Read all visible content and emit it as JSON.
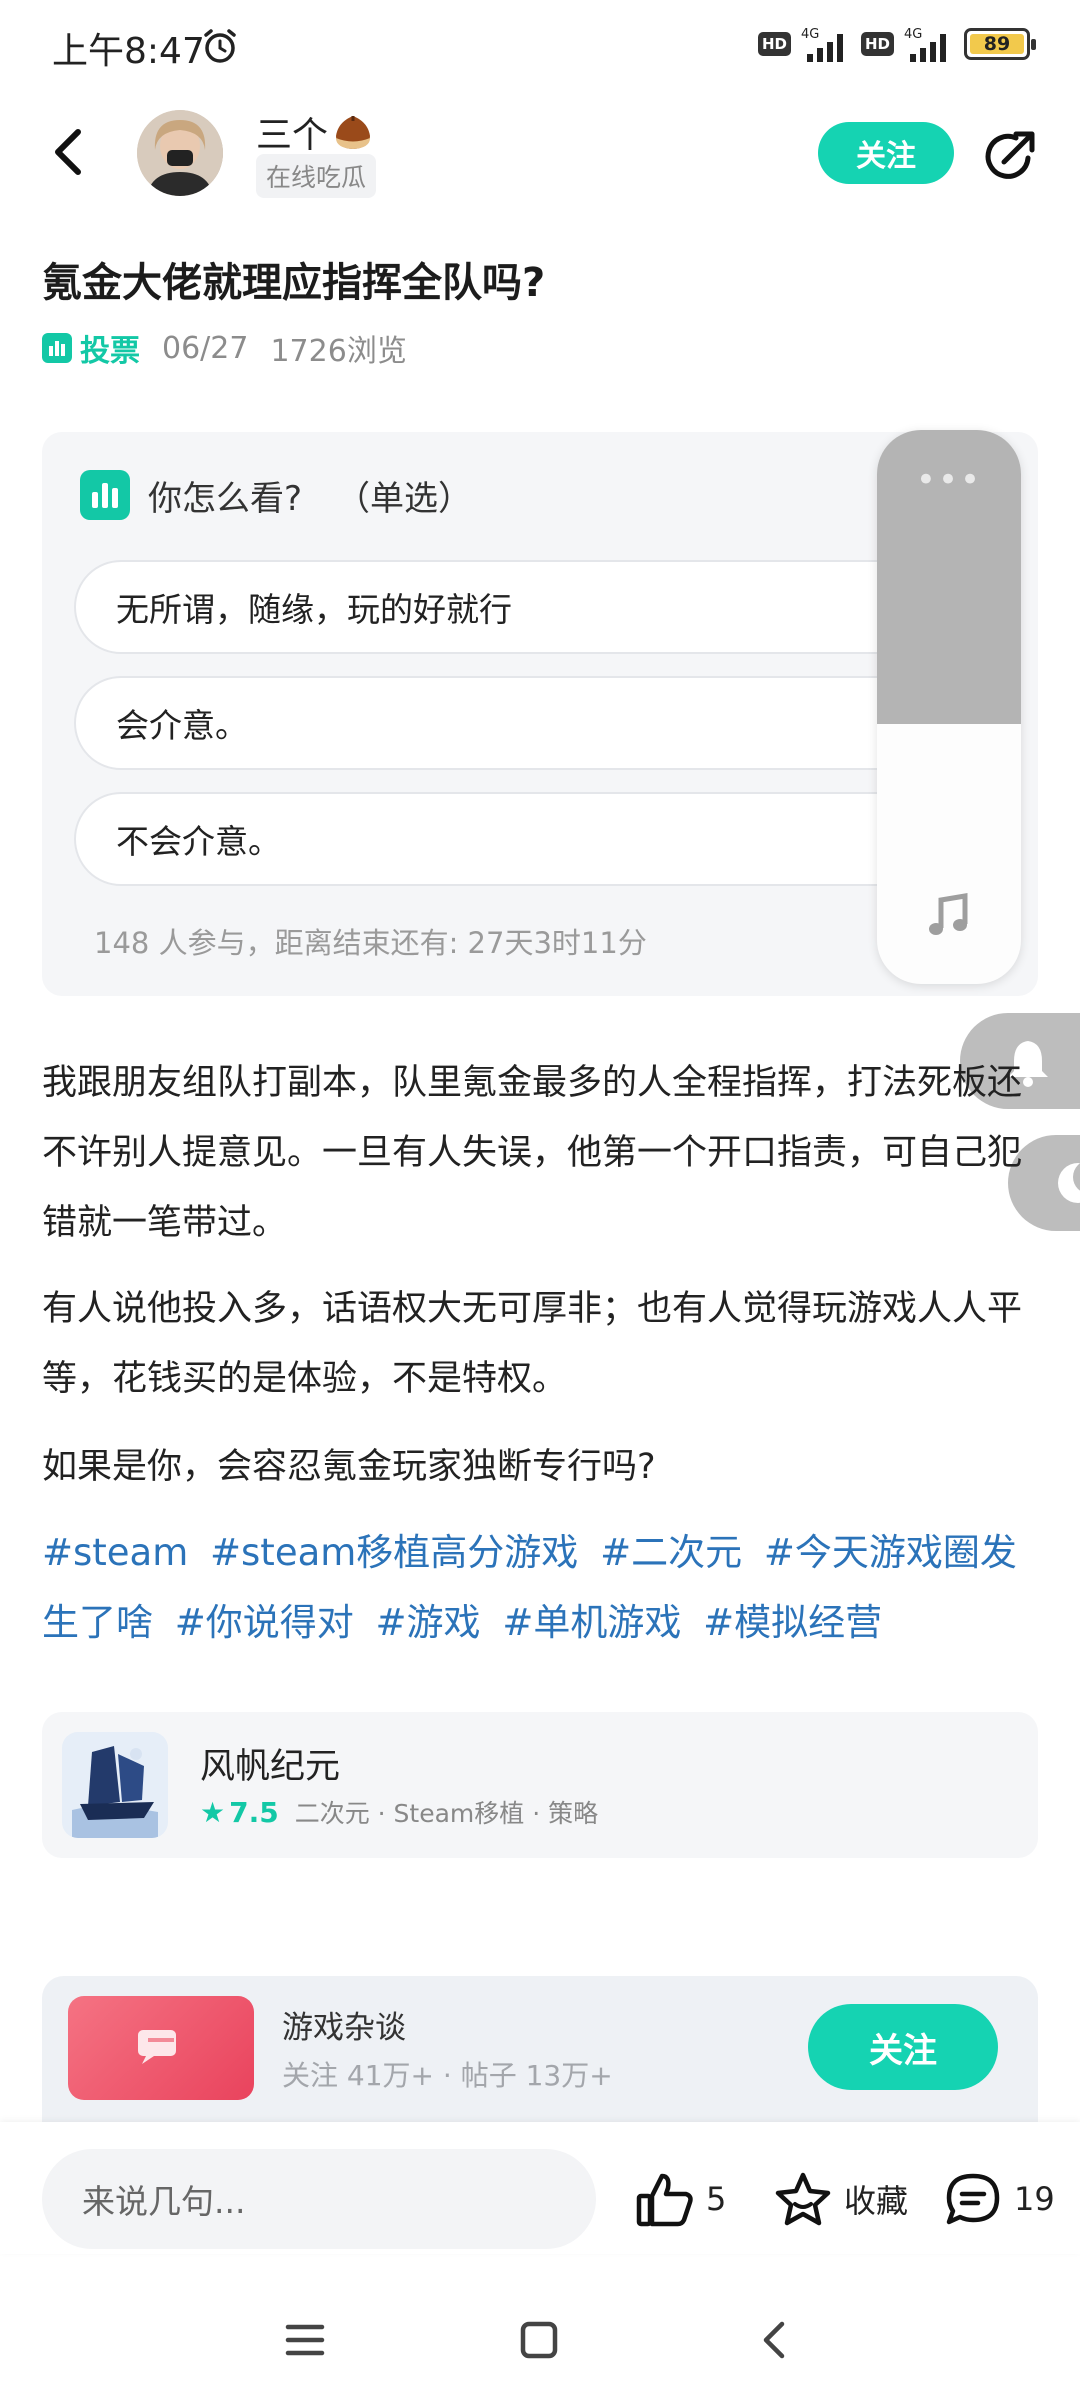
{
  "status_bar": {
    "time": "上午8:47",
    "network_1": "4G",
    "network_2": "4G",
    "hd_1": "HD",
    "hd_2": "HD",
    "battery": "89",
    "battery_color": "#f2c94c"
  },
  "header": {
    "author_name": "三个",
    "author_tag": "在线吃瓜",
    "follow_label": "关注",
    "accent_color": "#15d3b2"
  },
  "post": {
    "title": "氪金大佬就理应指挥全队吗?",
    "type_label": "投票",
    "date": "06/27",
    "views": "1726浏览"
  },
  "poll": {
    "question": "你怎么看?",
    "mode": "（单选）",
    "options": [
      {
        "label": "无所谓，随缘，玩的好就行"
      },
      {
        "label": "会介意。"
      },
      {
        "label": "不会介意。"
      }
    ],
    "footer": "148 人参与，距离结束还有: 27天3时11分"
  },
  "body": {
    "paragraphs": [
      "我跟朋友组队打副本，队里氪金最多的人全程指挥，打法死板还不许别人提意见。一旦有人失误，他第一个开口指责，可自己犯错就一笔带过。",
      "有人说他投入多，话语权大无可厚非；也有人觉得玩游戏人人平等，花钱买的是体验，不是特权。",
      "如果是你，会容忍氪金玩家独断专行吗?"
    ],
    "hashtags": [
      "#steam",
      "#steam移植高分游戏",
      "#二次元",
      "#今天游戏圈发生了啥",
      "#你说得对",
      "#游戏",
      "#单机游戏",
      "#模拟经营"
    ]
  },
  "game": {
    "name": "风帆纪元",
    "score": "7.5",
    "tags": "二次元 · Steam移植 · 策略"
  },
  "circle": {
    "name": "游戏杂谈",
    "stats": "关注 41万+  ·  帖子 13万+",
    "follow_label": "关注"
  },
  "bottom_bar": {
    "comment_placeholder": "来说几句...",
    "likes": "5",
    "favorite_label": "收藏",
    "comments": "19"
  },
  "icons": {
    "alarm": "alarm-clock-icon",
    "back": "back-arrow-icon",
    "share": "share-icon",
    "poll": "bar-chart-icon",
    "music": "music-note-icon",
    "bell": "bell-icon",
    "moon": "moon-icon",
    "like": "thumbs-up-icon",
    "favorite": "star-icon",
    "comment": "comment-icon"
  }
}
